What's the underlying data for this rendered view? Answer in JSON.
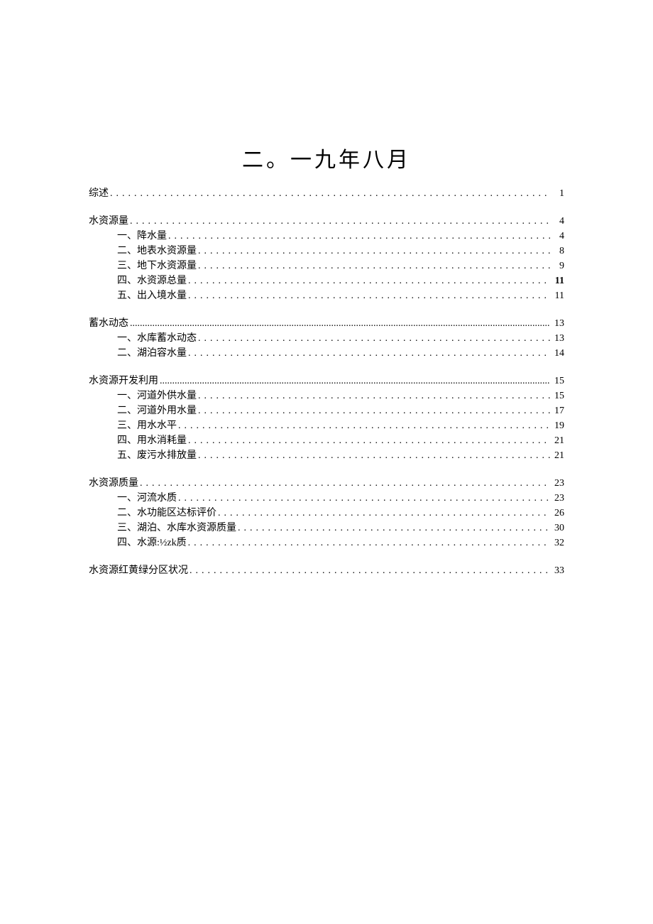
{
  "title": "二。一九年八月",
  "toc": [
    {
      "label": "综述",
      "page": "1",
      "level": 0,
      "dots": "sparse",
      "bold": false,
      "gap": false
    },
    {
      "label": "水资源量",
      "page": "4",
      "level": 0,
      "dots": "sparse",
      "bold": false,
      "gap": true
    },
    {
      "label": "一、降水量",
      "page": "4",
      "level": 1,
      "dots": "sparse",
      "bold": false,
      "gap": false
    },
    {
      "label": "二、地表水资源量",
      "page": "8",
      "level": 1,
      "dots": "sparse",
      "bold": false,
      "gap": false
    },
    {
      "label": "三、地下水资源量",
      "page": "9",
      "level": 1,
      "dots": "sparse",
      "bold": false,
      "gap": false
    },
    {
      "label": "四、水资源总量",
      "page": "11",
      "level": 1,
      "dots": "sparse",
      "bold": true,
      "gap": false
    },
    {
      "label": "五、出入境水量",
      "page": "11",
      "level": 1,
      "dots": "sparse",
      "bold": false,
      "gap": false
    },
    {
      "label": "蓄水动态",
      "page": "13",
      "level": 0,
      "dots": "dense",
      "bold": false,
      "gap": true
    },
    {
      "label": "一、水库蓄水动态",
      "page": "13",
      "level": 1,
      "dots": "sparse",
      "bold": false,
      "gap": false
    },
    {
      "label": "二、湖泊容水量",
      "page": "14",
      "level": 1,
      "dots": "sparse",
      "bold": false,
      "gap": false
    },
    {
      "label": "水资源开发利用",
      "page": "15",
      "level": 0,
      "dots": "dense",
      "bold": false,
      "gap": true
    },
    {
      "label": "一、河道外供水量",
      "page": "15",
      "level": 1,
      "dots": "sparse",
      "bold": false,
      "gap": false
    },
    {
      "label": "二、河道外用水量",
      "page": "17",
      "level": 1,
      "dots": "sparse",
      "bold": false,
      "gap": false
    },
    {
      "label": "三、用水水平",
      "page": "19",
      "level": 1,
      "dots": "sparse",
      "bold": false,
      "gap": false
    },
    {
      "label": "四、用水消耗量",
      "page": "21",
      "level": 1,
      "dots": "sparse",
      "bold": false,
      "gap": false
    },
    {
      "label": "五、废污水排放量",
      "page": "21",
      "level": 1,
      "dots": "sparse",
      "bold": false,
      "gap": false
    },
    {
      "label": "水资源质量",
      "page": "23",
      "level": 0,
      "dots": "sparse",
      "bold": false,
      "gap": true
    },
    {
      "label": "一、河流水质",
      "page": "23",
      "level": 1,
      "dots": "sparse",
      "bold": false,
      "gap": false
    },
    {
      "label": "二、水功能区达标评价",
      "page": "26",
      "level": 1,
      "dots": "sparse",
      "bold": false,
      "gap": false
    },
    {
      "label": "三、湖泊、水库水资源质量",
      "page": "30",
      "level": 1,
      "dots": "sparse",
      "bold": false,
      "gap": false
    },
    {
      "label": "四、水源:½zk质",
      "page": "32",
      "level": 1,
      "dots": "sparse",
      "bold": false,
      "gap": false
    },
    {
      "label": "水资源红黄绿分区状况",
      "page": "33",
      "level": 0,
      "dots": "sparse",
      "bold": false,
      "gap": true
    }
  ]
}
